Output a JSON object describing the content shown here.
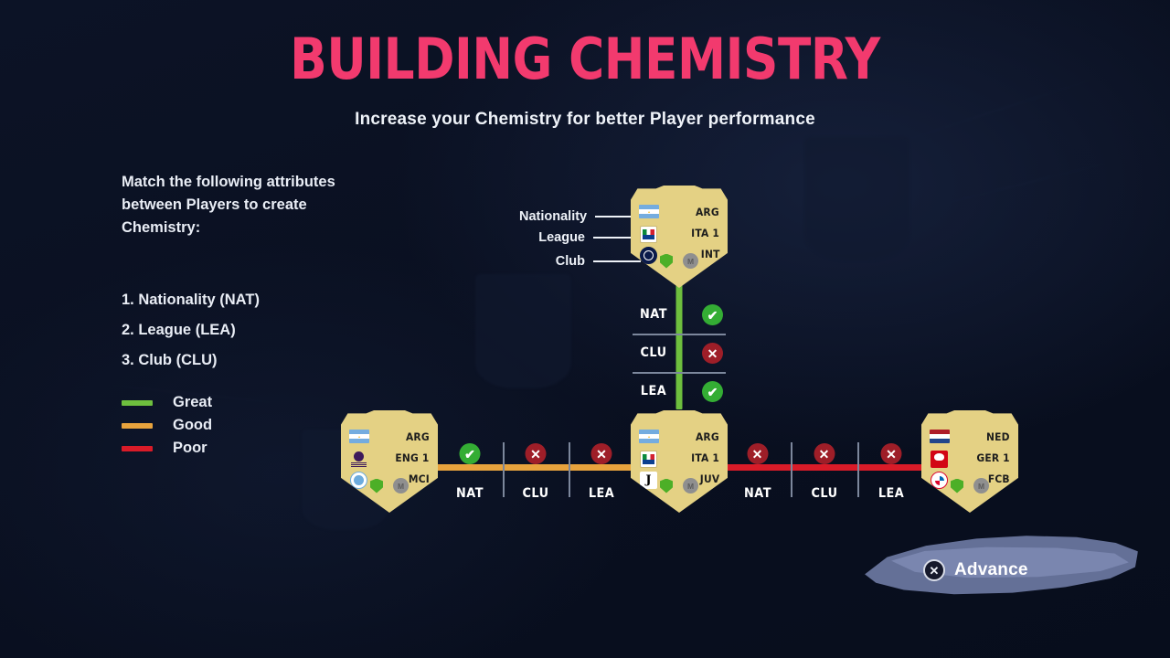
{
  "header": {
    "title": "BUILDING CHEMISTRY",
    "subtitle": "Increase your Chemistry for better Player performance",
    "title_color": "#f23a6e"
  },
  "intro": {
    "text": "Match the following attributes between Players to create Chemistry:"
  },
  "attributes": [
    {
      "text": "1. Nationality (NAT)"
    },
    {
      "text": "2. League (LEA)"
    },
    {
      "text": "3. Club (CLU)"
    }
  ],
  "legend": [
    {
      "label": "Great",
      "color": "#6ebf3e"
    },
    {
      "label": "Good",
      "color": "#e8a33d"
    },
    {
      "label": "Poor",
      "color": "#d91b28"
    }
  ],
  "callouts": [
    {
      "label": "Nationality"
    },
    {
      "label": "League"
    },
    {
      "label": "Club"
    }
  ],
  "cards": {
    "top": {
      "nationality": "ARG",
      "league": "ITA 1",
      "club": "INT",
      "nationality_icon": "flag-argentina",
      "league_icon": "serie-a-logo",
      "club_icon": "inter-milan-badge",
      "chem_shield": "chemistry-shield",
      "position": "M"
    },
    "left": {
      "nationality": "ARG",
      "league": "ENG 1",
      "club": "MCI",
      "nationality_icon": "flag-argentina",
      "league_icon": "premier-league-logo",
      "club_icon": "man-city-badge",
      "chem_shield": "chemistry-shield",
      "position": "M"
    },
    "center": {
      "nationality": "ARG",
      "league": "ITA 1",
      "club": "JUV",
      "nationality_icon": "flag-argentina",
      "league_icon": "serie-a-logo",
      "club_icon": "juventus-badge",
      "chem_shield": "chemistry-shield",
      "position": "M"
    },
    "right": {
      "nationality": "NED",
      "league": "GER 1",
      "club": "FCB",
      "nationality_icon": "flag-netherlands",
      "league_icon": "bundesliga-logo",
      "club_icon": "bayern-munich-badge",
      "chem_shield": "chemistry-shield",
      "position": "M"
    }
  },
  "links": {
    "vertical": {
      "quality": "Great",
      "color": "#6ebf3e",
      "rows": [
        {
          "label": "NAT",
          "status": "match",
          "icon": "check-icon"
        },
        {
          "label": "CLU",
          "status": "no-match",
          "icon": "cross-icon"
        },
        {
          "label": "LEA",
          "status": "match",
          "icon": "check-icon"
        }
      ]
    },
    "left": {
      "quality": "Good",
      "color": "#e8a33d",
      "cells": [
        {
          "label": "NAT",
          "status": "match",
          "icon": "check-icon"
        },
        {
          "label": "CLU",
          "status": "no-match",
          "icon": "cross-icon"
        },
        {
          "label": "LEA",
          "status": "no-match",
          "icon": "cross-icon"
        }
      ]
    },
    "right": {
      "quality": "Poor",
      "color": "#d91b28",
      "cells": [
        {
          "label": "NAT",
          "status": "no-match",
          "icon": "cross-icon"
        },
        {
          "label": "CLU",
          "status": "no-match",
          "icon": "cross-icon"
        },
        {
          "label": "LEA",
          "status": "no-match",
          "icon": "cross-icon"
        }
      ]
    }
  },
  "footer": {
    "advance_label": "Advance",
    "advance_button_glyph": "✕",
    "advance_button_icon": "playstation-cross-button"
  },
  "icons": {
    "check": "✔",
    "cross": "✕"
  }
}
